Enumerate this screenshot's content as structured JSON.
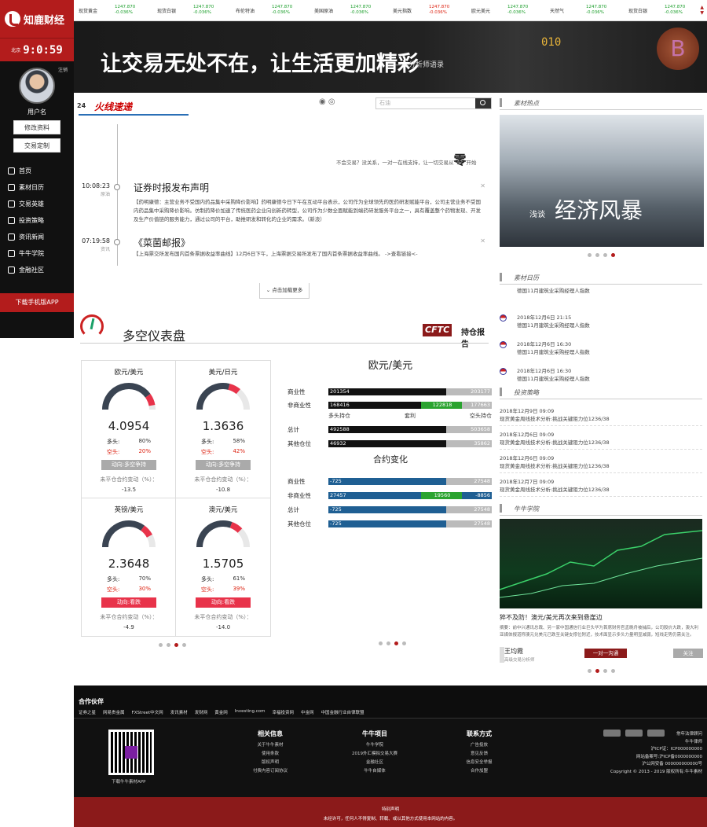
{
  "app": {
    "brand": "知鹿财经",
    "clock_city": "北京",
    "clock_time": "9:0:59"
  },
  "user": {
    "logout": "注销",
    "name": "用户名",
    "edit_profile": "修改资料",
    "trade_custom": "交易定制"
  },
  "nav": [
    {
      "label": "首页",
      "icon": "home-icon"
    },
    {
      "label": "素材日历",
      "icon": "calendar-icon"
    },
    {
      "label": "交易英雄",
      "icon": "hero-icon"
    },
    {
      "label": "投资策略",
      "icon": "strategy-icon"
    },
    {
      "label": "资讯新闻",
      "icon": "news-icon"
    },
    {
      "label": "牛牛学院",
      "icon": "school-icon"
    },
    {
      "label": "金融社区",
      "icon": "community-icon"
    }
  ],
  "download_app": "下载手机版APP",
  "ticker": [
    {
      "name": "现货黄金",
      "value": "1247.870",
      "change": "-0.036%",
      "color": "green"
    },
    {
      "name": "现货白银",
      "value": "1247.870",
      "change": "-0.036%",
      "color": "green"
    },
    {
      "name": "布伦特油",
      "value": "1247.870",
      "change": "-0.036%",
      "color": "green"
    },
    {
      "name": "美国原油",
      "value": "1247.870",
      "change": "-0.036%",
      "color": "green"
    },
    {
      "name": "美元指数",
      "value": "1247.870",
      "change": "-0.036%",
      "color": "red"
    },
    {
      "name": "欧元美元",
      "value": "1247.870",
      "change": "-0.036%",
      "color": "green"
    },
    {
      "name": "天然气",
      "value": "1247.870",
      "change": "-0.036%",
      "color": "green"
    },
    {
      "name": "现货白银",
      "value": "1247.870",
      "change": "-0.036%",
      "color": "green"
    }
  ],
  "banner": {
    "slogan": "让交易无处不在，让生活更加精彩",
    "sub": "——分析师语录",
    "binary": "010",
    "coin": "B"
  },
  "flash": {
    "num": "24",
    "title": "火线速递",
    "search_placeholder": "石油"
  },
  "promo": {
    "text1": "不会交易？没关系，一对一在线支持，让一切交易从",
    "big": "零",
    "text2": "开始"
  },
  "news": [
    {
      "time": "10:08:23",
      "src": "原油",
      "title": "证券时报发布声明",
      "body": "【药明康德：主营业务不受国内药品集中采购降价影响】药明康德今日下午在互动平台表示，公司作为全球领先的医药研发赋能平台，公司主营业务不受国内药品集中采购降价影响。仿制药降价加速了传统医药企业向创新药转型，公司作为少数全面赋能到端药研发服务平台之一，具有覆盖整个药物发现、开发及生产价值链的服务能力，通过公司的平台，助推研发和转化的企业的需求。（新浪）"
    },
    {
      "time": "07:19:58",
      "src": "资讯",
      "title": "《菜菌邮报》",
      "body": "【上海票交所发布国内首条票据收益率曲线】12月6日下午，上海票据交易所发布了国内首条票据收益率曲线。 ->查看链接<-"
    }
  ],
  "load_more": "点击加载更多",
  "longshort": {
    "title": "多空仪表盘",
    "cftc": "CFTC",
    "cftc_report": "持仓报告"
  },
  "gauges": [
    {
      "pair": "欧元/美元",
      "value": "4.0954",
      "long_label": "多头:",
      "long": "80%",
      "short_label": "空头:",
      "short": "20%",
      "direction": "动向:多空争持",
      "dir_color": "#aaaaaa",
      "uncovered_label": "未平仓合约变动（%）：",
      "uncovered": "-13.5",
      "level": 0.8
    },
    {
      "pair": "美元/日元",
      "value": "1.3636",
      "long_label": "多头:",
      "long": "58%",
      "short_label": "空头:",
      "short": "42%",
      "direction": "动向:多空争持",
      "dir_color": "#aaaaaa",
      "uncovered_label": "未平仓合约变动（%）：",
      "uncovered": "-10.8",
      "level": 0.58
    },
    {
      "pair": "英镑/美元",
      "value": "2.3648",
      "long_label": "多头:",
      "long": "70%",
      "short_label": "空头:",
      "short": "30%",
      "direction": "动向:看跌",
      "dir_color": "#e8334a",
      "uncovered_label": "未平仓合约变动（%）：",
      "uncovered": "-4.9",
      "level": 0.7
    },
    {
      "pair": "澳元/美元",
      "value": "1.5705",
      "long_label": "多头:",
      "long": "61%",
      "short_label": "空头:",
      "short": "39%",
      "direction": "动向:看跌",
      "dir_color": "#e8334a",
      "uncovered_label": "未平仓合约变动（%）：",
      "uncovered": "-14.0",
      "level": 0.61
    }
  ],
  "cot": {
    "title": "欧元/美元",
    "rows": [
      {
        "label": "商业性",
        "left": "201354",
        "mid": "",
        "right": "203177"
      },
      {
        "label": "非商业性",
        "left": "168416",
        "mid": "122818",
        "right": "177663"
      }
    ],
    "hdr": {
      "a": "多头持仓",
      "b": "套利",
      "c": "空头持仓"
    },
    "rows2": [
      {
        "label": "总计",
        "left": "492588",
        "right": "503658"
      },
      {
        "label": "其他仓位",
        "left": "46932",
        "right": "35862"
      }
    ],
    "change_title": "合约变化",
    "change_rows": [
      {
        "label": "商业性",
        "left": "-725",
        "mid": "",
        "right": "27548"
      },
      {
        "label": "非商业性",
        "left": "27457",
        "mid": "19560",
        "right": "-8856"
      },
      {
        "label": "总计",
        "left": "-725",
        "mid": "",
        "right": "27548"
      },
      {
        "label": "其他仓位",
        "left": "-725",
        "mid": "",
        "right": "27548"
      }
    ]
  },
  "right": {
    "hot": "素材热点",
    "hot_img_small": "浅谈",
    "hot_img_big": "经济风暴",
    "calendar": "素材日历",
    "cal_items": [
      {
        "date": "",
        "text": "德国11月建筑业采购经理人指数"
      },
      {
        "date": "2018年12月6日 21:15",
        "text": "德国11月建筑业采购经理人指数"
      },
      {
        "date": "2018年12月6日 16:30",
        "text": "德国11月建筑业采购经理人指数"
      },
      {
        "date": "2018年12月6日 16:30",
        "text": "德国11月建筑业采购经理人指数"
      }
    ],
    "strategy": "投资策略",
    "strat_items": [
      {
        "date": "2018年12月9日 09:09",
        "text": "现货黄金周线技术分析:挑战关键阻力位1236/38"
      },
      {
        "date": "2018年12月6日 09:09",
        "text": "现货黄金周线技术分析:挑战关键阻力位1236/38"
      },
      {
        "date": "2018年12月6日 09:09",
        "text": "现货黄金周线技术分析:挑战关键阻力位1236/38"
      },
      {
        "date": "2018年12月7日 09:09",
        "text": "现货黄金周线技术分析:挑战关键阻力位1236/38"
      }
    ],
    "school": "牛牛学院",
    "article_title": "猝不及防！澳元/美元再次来到悬崖边",
    "article_body": "摘要：前中兴通讯总裁、另一家中国通信行业巨头华为首席财务官孟晚舟被捕后，公司股价大跌，澳大利亚媒体报道称澳元兑美元已跌至关键支撑位附近，技术面显示多头力量明显减弱，短线走势仍需关注。",
    "author": "王均霞",
    "author_sub": "高级交易分析师",
    "chat": "一对一沟通",
    "follow": "关注"
  },
  "footer": {
    "partners_title": "合作伙伴",
    "partners": [
      "证券之星",
      "网易贵金属",
      "FXStreet中文网",
      "发讯素材",
      "发财网",
      "黄金网",
      "Investing.com",
      "幸福投资网",
      "中金网",
      "中国金融行业自律联盟"
    ],
    "qr_label": "下载牛牛素材APP",
    "cols": [
      {
        "h": "相关信息",
        "items": [
          "关于牛牛素材",
          "使用条款",
          "版权声明",
          "付费内容订阅协议"
        ]
      },
      {
        "h": "牛牛项目",
        "items": [
          "牛牛学院",
          "2019外汇模拟交易大赛",
          "金融社区",
          "牛牛自媒体"
        ]
      },
      {
        "h": "联系方式",
        "items": [
          "广告投放",
          "意见反馈",
          "信息安全举报",
          "合作加盟"
        ]
      }
    ],
    "right_lines": [
      "常年法律顾问",
      "牛牛律师",
      "沪ICP证：ICP000000000",
      "网站备案号:沪ICP备0000000000",
      "沪公网安备 000000000000号",
      "Copyright © 2013 - 2019 版权所有:牛牛素材"
    ],
    "disclaimer_t": "特别声明",
    "disclaimer": "未经许可，任何人不得复制、转载、或以其他方式使用本网站的内容。"
  }
}
